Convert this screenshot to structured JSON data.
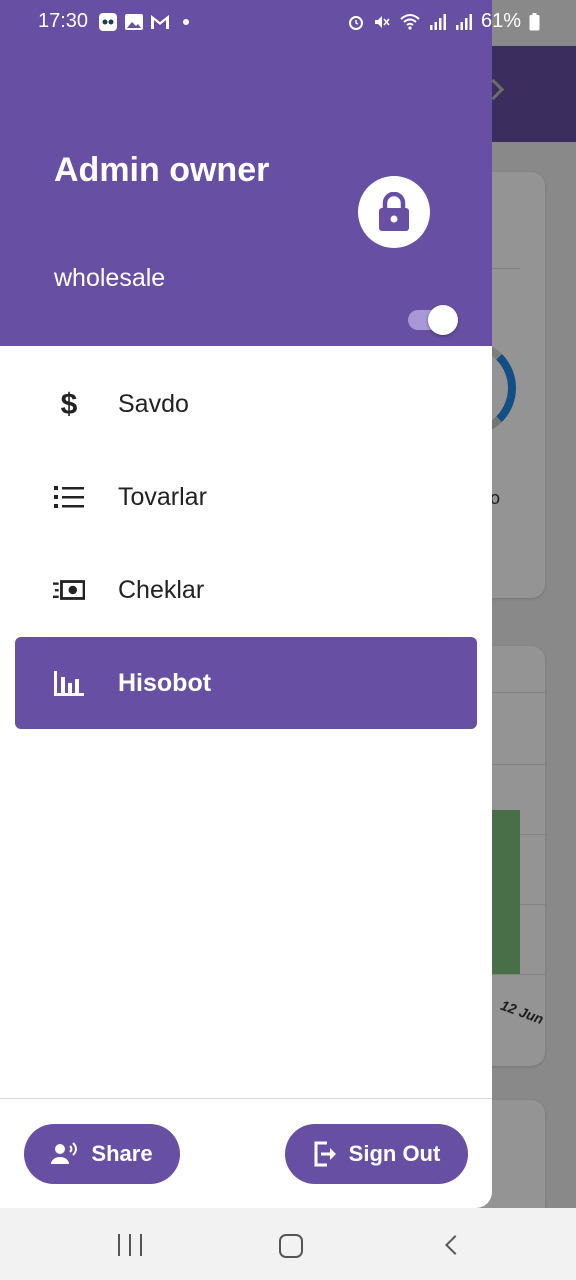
{
  "status_bar": {
    "time": "17:30",
    "battery": "61%",
    "left_icons": [
      "robot-app-icon",
      "image-icon",
      "gmail-icon",
      "dot-icon"
    ],
    "right_icons": [
      "alarm-icon",
      "mute-icon",
      "wifi-icon",
      "signal-icon",
      "signal-icon",
      "battery-icon"
    ]
  },
  "drawer": {
    "user_name": "Admin owner",
    "user_type": "wholesale",
    "lock_icon": "lock-icon",
    "toggle_on": true,
    "menu": [
      {
        "label": "Savdo",
        "icon": "dollar-icon",
        "active": false
      },
      {
        "label": "Tovarlar",
        "icon": "list-icon",
        "active": false
      },
      {
        "label": "Cheklar",
        "icon": "receipt-money-icon",
        "active": false
      },
      {
        "label": "Hisobot",
        "icon": "bar-chart-icon",
        "active": true
      }
    ],
    "footer": {
      "share_label": "Share",
      "signout_label": "Sign Out"
    }
  },
  "background": {
    "chart_label": "12 Jun",
    "partial_text": "o"
  },
  "colors": {
    "primary": "#6750a4",
    "toggle_track": "#a898d8",
    "ring_accent": "#1e88e5",
    "bar_green": "#7cc07a"
  }
}
